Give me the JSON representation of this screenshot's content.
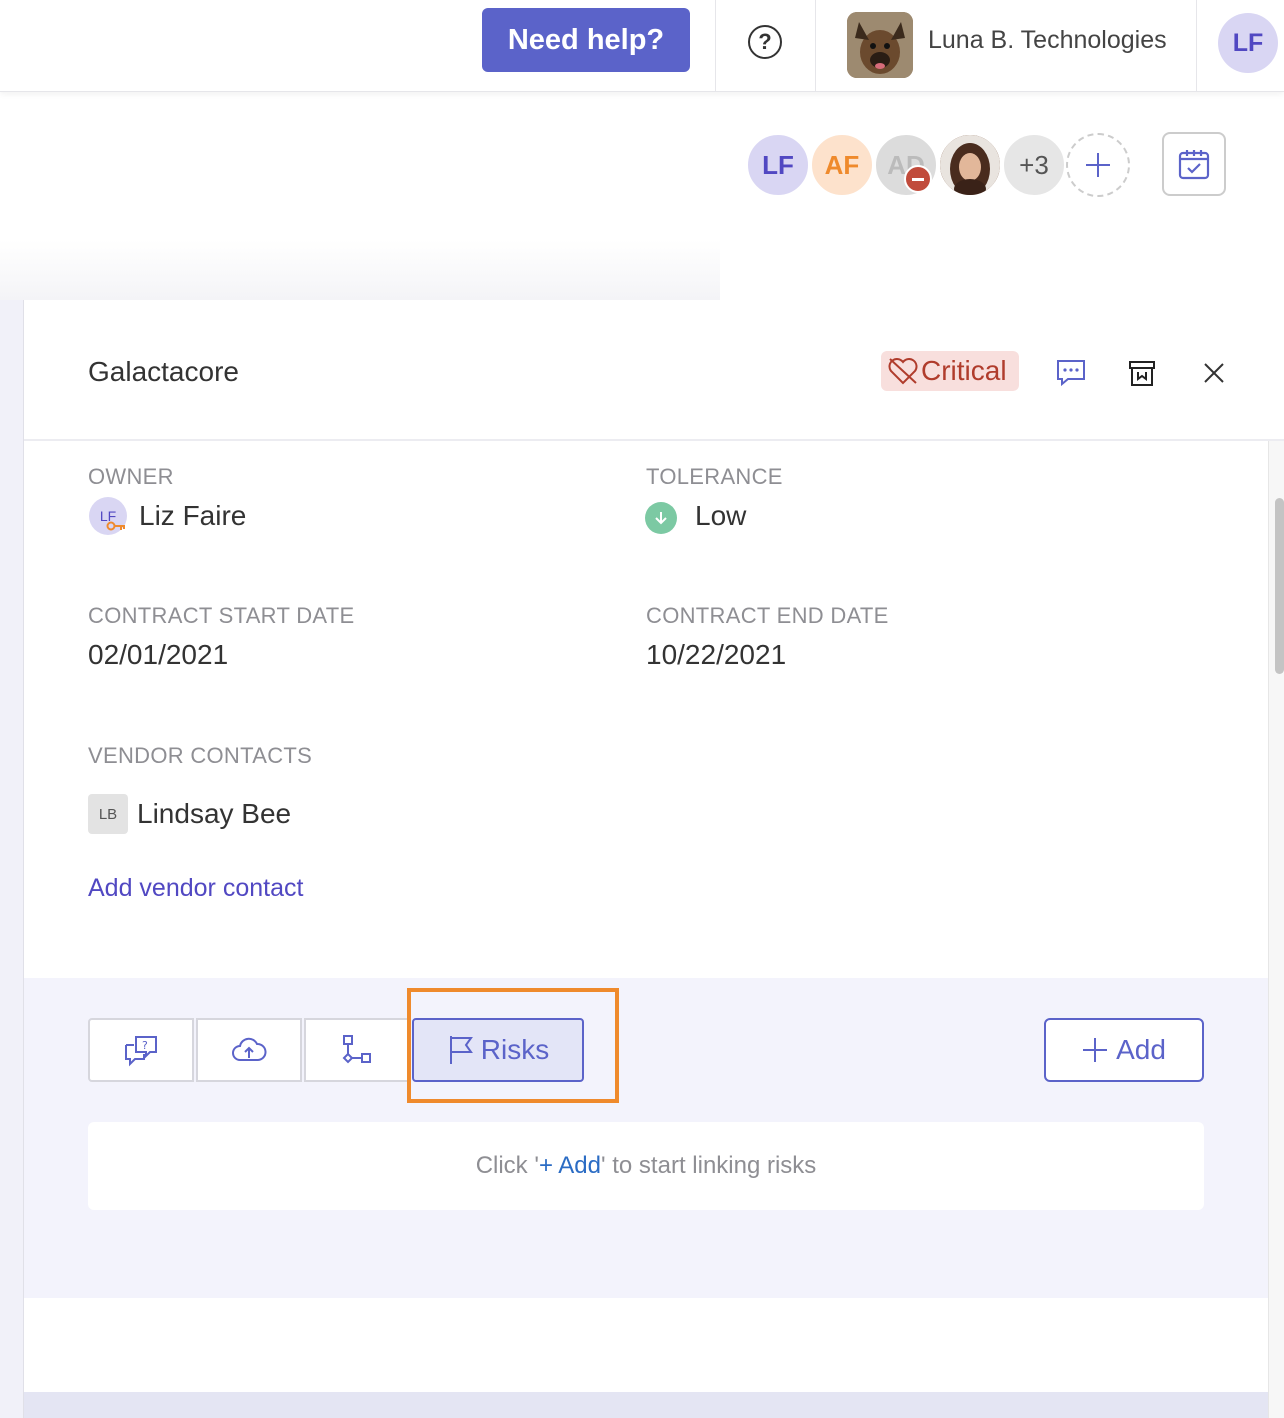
{
  "topbar": {
    "help_label": "Need help?",
    "help_icon": "question-circle-icon",
    "org_name": "Luna B. Technologies",
    "user_initials": "LF"
  },
  "collaborators": {
    "items": [
      {
        "initials": "LF"
      },
      {
        "initials": "AF"
      },
      {
        "initials": "AD"
      },
      {
        "initials": ""
      },
      {
        "initials": "+3"
      }
    ],
    "add_icon": "plus-icon",
    "calendar_icon": "calendar-check-icon"
  },
  "vendor": {
    "name": "Galactacore",
    "criticality": "Critical",
    "criticality_icon": "broken-heart-icon",
    "colors": {
      "critical_bg": "#f8dfdd",
      "critical_text": "#b03c2c",
      "accent": "#5b63c9",
      "highlight": "#ef8a2c"
    }
  },
  "fields": {
    "owner_label": "OWNER",
    "owner_initials": "LF",
    "owner_value": "Liz Faire",
    "tolerance_label": "TOLERANCE",
    "tolerance_value": "Low",
    "start_label": "CONTRACT START DATE",
    "start_value": "02/01/2021",
    "end_label": "CONTRACT END DATE",
    "end_value": "10/22/2021",
    "contacts_label": "VENDOR CONTACTS",
    "contact_initials": "LB",
    "contact_name": "Lindsay Bee",
    "add_contact_label": "Add vendor contact"
  },
  "tabs": {
    "items": [
      {
        "icon": "chat-question-icon"
      },
      {
        "icon": "cloud-upload-icon"
      },
      {
        "icon": "flow-diagram-icon"
      },
      {
        "icon": "flag-icon",
        "label": "Risks"
      }
    ],
    "add_label": "Add",
    "empty_prefix": "Click '",
    "empty_link": "+ Add",
    "empty_suffix": "' to start linking risks"
  }
}
